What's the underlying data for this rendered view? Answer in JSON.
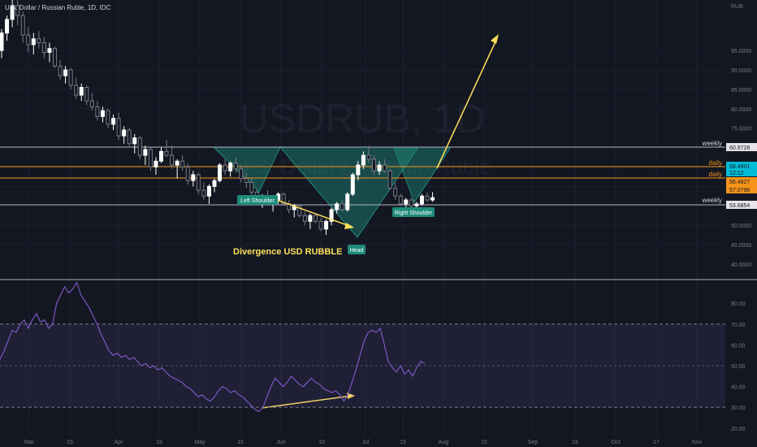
{
  "header": {
    "symbol_description": "U.S. Dollar / Russian Ruble, 1D, IDC",
    "currency": "RUB"
  },
  "watermark": {
    "ticker": "USDRUB, 1D",
    "name": "U.S. Dollar / Russian Ruble"
  },
  "colors": {
    "background": "#131722",
    "bull_candle": "#ffffff",
    "bear_candle": "#787b86",
    "level_line_weekly": "#b2b5be",
    "level_line_daily": "#f7931a",
    "pattern_fill": "#1e8a7a",
    "annotation_yellow": "#ffe15a",
    "pattern_label_bg": "#1e8a7a",
    "rsi_line": "#7e57c2",
    "rsi_band": "#7e57c2"
  },
  "chart_data": [
    {
      "type": "candlestick",
      "title": "",
      "pattern": "Inverse head and shoulders",
      "y_axis": {
        "ticks": [
          "95.0000",
          "90.0000",
          "85.0000",
          "80.0000",
          "75.0000",
          "70.0000",
          "65.0000",
          "60.0000",
          "55.0000",
          "50.0000",
          "45.0000",
          "40.0000"
        ],
        "ylim": [
          36,
          108
        ]
      },
      "x_axis": {
        "ticks": [
          "Mar",
          "15",
          "Apr",
          "15",
          "May",
          "15",
          "Jun",
          "15",
          "Jul",
          "15",
          "Aug",
          "15",
          "Sep",
          "15",
          "Oct",
          "17",
          "Nov"
        ]
      },
      "levels": [
        {
          "label": "weekly",
          "value": 60.9728,
          "value_label": "60.9728",
          "kind": "weekly"
        },
        {
          "label": "daily",
          "value": 58.4901,
          "value_label": "58.4901",
          "kind": "daily-current",
          "countdown": "12:12"
        },
        {
          "label": "daily",
          "value": 56.4827,
          "value_label": "56.4827",
          "kind": "daily"
        },
        {
          "label": "",
          "value": 57.0796,
          "value_label": "57.0796",
          "kind": "last-price"
        },
        {
          "label": "weekly",
          "value": 53.6854,
          "value_label": "53.6854",
          "kind": "weekly"
        }
      ],
      "pattern_labels": [
        {
          "text": "Left Shoulder"
        },
        {
          "text": "Head"
        },
        {
          "text": "Right Shoulder"
        }
      ],
      "annotation": "Divergence USD RUBBLE",
      "candles_ohlc": [
        [
          95.0,
          100.5,
          93.0,
          99.5
        ],
        [
          99.5,
          104.0,
          97.5,
          103.0
        ],
        [
          103.0,
          108.0,
          101.0,
          106.5
        ],
        [
          106.5,
          108.0,
          101.5,
          104.0
        ],
        [
          104.0,
          105.0,
          97.0,
          99.0
        ],
        [
          99.0,
          101.0,
          94.5,
          96.5
        ],
        [
          96.5,
          99.5,
          94.0,
          98.0
        ],
        [
          98.0,
          100.0,
          95.5,
          97.0
        ],
        [
          97.0,
          98.5,
          93.0,
          94.5
        ],
        [
          94.5,
          97.0,
          92.0,
          95.5
        ],
        [
          95.5,
          96.0,
          90.5,
          91.0
        ],
        [
          91.0,
          92.5,
          87.5,
          88.5
        ],
        [
          88.5,
          91.0,
          86.5,
          90.0
        ],
        [
          90.0,
          90.5,
          85.0,
          86.0
        ],
        [
          86.0,
          88.0,
          82.5,
          83.5
        ],
        [
          83.5,
          86.5,
          82.0,
          85.5
        ],
        [
          85.5,
          86.0,
          81.0,
          82.0
        ],
        [
          82.0,
          84.0,
          79.5,
          80.5
        ],
        [
          80.5,
          82.0,
          77.0,
          78.0
        ],
        [
          78.0,
          80.5,
          76.5,
          79.5
        ],
        [
          79.5,
          80.0,
          75.0,
          76.0
        ],
        [
          76.0,
          78.5,
          74.5,
          77.5
        ],
        [
          77.5,
          79.0,
          72.0,
          73.0
        ],
        [
          73.0,
          75.5,
          71.0,
          74.5
        ],
        [
          74.5,
          75.0,
          70.0,
          71.0
        ],
        [
          71.0,
          73.5,
          68.5,
          72.5
        ],
        [
          72.5,
          73.0,
          67.0,
          68.0
        ],
        [
          68.0,
          70.5,
          65.5,
          69.5
        ],
        [
          69.5,
          70.0,
          64.0,
          65.0
        ],
        [
          65.0,
          67.5,
          63.0,
          66.5
        ],
        [
          66.5,
          70.0,
          66.0,
          69.0
        ],
        [
          69.0,
          72.0,
          67.5,
          68.0
        ],
        [
          68.0,
          70.5,
          64.5,
          65.5
        ],
        [
          65.5,
          67.0,
          62.0,
          66.5
        ],
        [
          66.5,
          68.0,
          64.0,
          65.0
        ],
        [
          65.0,
          66.0,
          60.5,
          61.5
        ],
        [
          61.5,
          64.0,
          60.0,
          63.0
        ],
        [
          63.0,
          63.5,
          58.0,
          59.0
        ],
        [
          59.0,
          61.0,
          56.5,
          57.5
        ],
        [
          57.5,
          60.5,
          55.5,
          60.0
        ],
        [
          60.0,
          62.0,
          58.5,
          61.5
        ],
        [
          61.5,
          66.0,
          61.0,
          65.5
        ],
        [
          65.5,
          67.0,
          63.0,
          64.0
        ],
        [
          64.0,
          66.5,
          62.5,
          66.0
        ],
        [
          66.0,
          67.5,
          63.5,
          64.5
        ],
        [
          64.5,
          65.5,
          61.0,
          62.0
        ],
        [
          62.0,
          63.5,
          59.5,
          61.0
        ],
        [
          61.0,
          62.0,
          57.5,
          58.5
        ],
        [
          58.5,
          59.5,
          55.5,
          56.5
        ],
        [
          56.5,
          58.0,
          54.5,
          57.5
        ],
        [
          57.5,
          59.0,
          55.0,
          55.5
        ],
        [
          55.5,
          57.5,
          53.5,
          56.5
        ],
        [
          56.5,
          58.5,
          55.5,
          58.0
        ],
        [
          58.0,
          58.5,
          55.0,
          55.5
        ],
        [
          55.5,
          56.5,
          53.0,
          54.0
        ],
        [
          54.0,
          55.5,
          52.0,
          55.0
        ],
        [
          55.0,
          55.5,
          52.0,
          52.5
        ],
        [
          52.5,
          53.5,
          50.0,
          51.0
        ],
        [
          51.0,
          53.0,
          49.0,
          52.5
        ],
        [
          52.5,
          53.0,
          50.5,
          51.0
        ],
        [
          51.0,
          52.0,
          48.5,
          49.0
        ],
        [
          49.0,
          51.5,
          47.5,
          51.0
        ],
        [
          51.0,
          54.5,
          50.0,
          54.0
        ],
        [
          54.0,
          56.0,
          53.0,
          55.5
        ],
        [
          55.5,
          56.5,
          53.5,
          54.0
        ],
        [
          54.0,
          58.5,
          53.5,
          58.0
        ],
        [
          58.0,
          63.5,
          57.5,
          63.0
        ],
        [
          63.0,
          66.5,
          61.5,
          65.5
        ],
        [
          65.5,
          69.0,
          64.5,
          68.0
        ],
        [
          68.0,
          70.5,
          66.0,
          67.0
        ],
        [
          67.0,
          68.0,
          63.0,
          64.0
        ],
        [
          64.0,
          66.5,
          63.0,
          65.5
        ],
        [
          65.5,
          67.0,
          63.5,
          64.0
        ],
        [
          64.0,
          64.5,
          59.0,
          59.5
        ],
        [
          59.5,
          61.0,
          56.5,
          57.5
        ],
        [
          57.5,
          58.0,
          55.0,
          55.5
        ],
        [
          55.5,
          57.0,
          54.0,
          56.5
        ],
        [
          56.5,
          57.0,
          54.5,
          55.0
        ],
        [
          55.0,
          56.0,
          53.5,
          55.5
        ],
        [
          55.5,
          58.0,
          55.0,
          57.5
        ],
        [
          57.5,
          58.5,
          56.0,
          56.5
        ],
        [
          56.5,
          58.5,
          56.0,
          57.1
        ]
      ]
    },
    {
      "type": "line",
      "indicator": "RSI",
      "bands": [
        70,
        50,
        30
      ],
      "y_axis": {
        "ticks": [
          "80.00",
          "70.00",
          "60.00",
          "50.00",
          "40.00",
          "30.00",
          "20.00"
        ],
        "ylim": [
          16,
          91
        ]
      },
      "values": [
        53,
        57,
        62,
        67,
        66,
        70,
        72,
        68,
        72,
        75,
        71,
        72,
        68,
        70,
        80,
        84,
        88,
        85,
        87,
        90,
        84,
        81,
        78,
        74,
        70,
        65,
        61,
        57,
        55,
        56,
        54,
        55,
        53,
        54,
        52,
        50,
        51,
        49,
        50,
        48,
        49,
        47,
        45,
        44,
        43,
        42,
        40,
        39,
        37,
        35,
        36,
        34,
        33,
        35,
        38,
        40,
        39,
        37,
        38,
        36,
        35,
        33,
        31,
        29,
        28,
        30,
        35,
        40,
        44,
        42,
        40,
        42,
        45,
        43,
        41,
        40,
        42,
        44,
        42,
        41,
        39,
        38,
        37,
        38,
        36,
        33,
        36,
        42,
        48,
        55,
        62,
        66,
        67,
        66,
        68,
        60,
        52,
        49,
        47,
        50,
        46,
        48,
        45,
        49,
        52,
        51
      ]
    }
  ]
}
